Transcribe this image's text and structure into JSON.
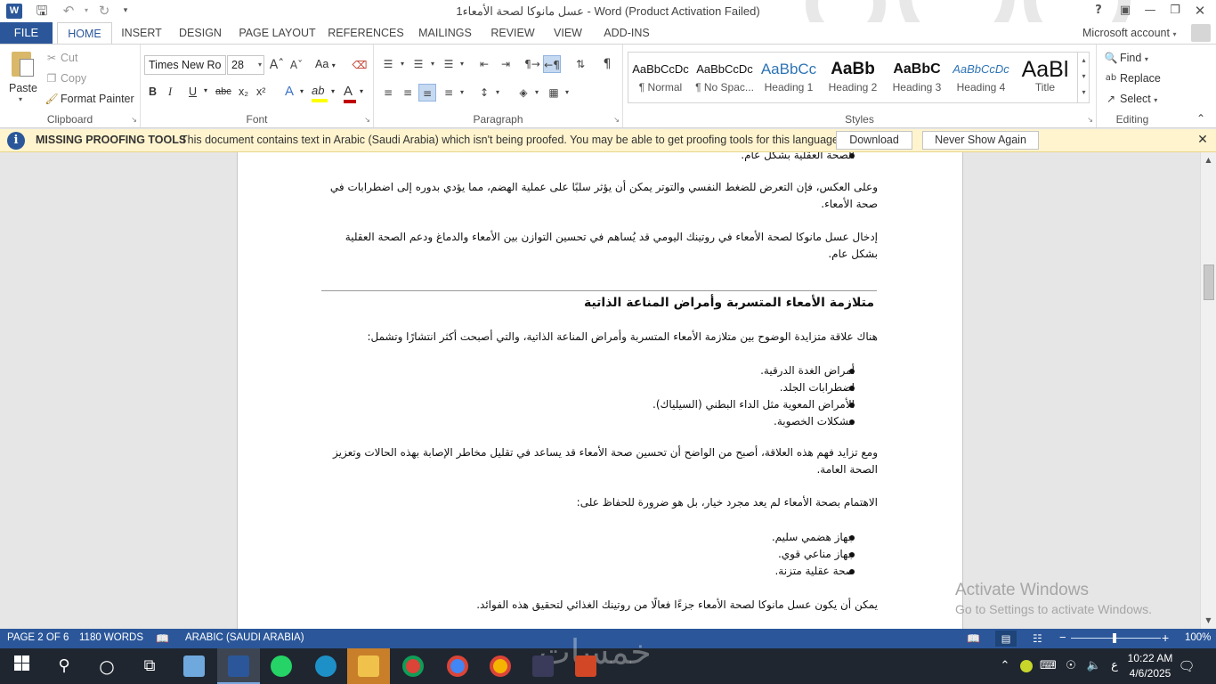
{
  "window": {
    "title": "عسل مانوكا لصحة الأمعاء1 - Word (Product Activation Failed)",
    "app_icon": "W",
    "help": "?",
    "controls": [
      "restore-ribbon-icon",
      "minimize-icon",
      "restore-icon",
      "close-icon"
    ]
  },
  "tabs": {
    "file": "FILE",
    "items": [
      "HOME",
      "INSERT",
      "DESIGN",
      "PAGE LAYOUT",
      "REFERENCES",
      "MAILINGS",
      "REVIEW",
      "VIEW",
      "ADD-INS"
    ],
    "active": "HOME",
    "account": "Microsoft account"
  },
  "ribbon": {
    "clipboard": {
      "label": "Clipboard",
      "paste": "Paste",
      "cut": "Cut",
      "copy": "Copy",
      "format_painter": "Format Painter"
    },
    "font": {
      "label": "Font",
      "family": "Times New Ro",
      "size": "28",
      "change_case": "Aa",
      "bold": "B",
      "italic": "I",
      "underline": "U",
      "strike": "abc",
      "subscript": "x₂",
      "superscript": "x²",
      "effects": "A",
      "highlight": "ab",
      "color": "A",
      "highlight_color": "#ffff00",
      "font_color": "#c00000"
    },
    "paragraph": {
      "label": "Paragraph",
      "pilcrow": "¶"
    },
    "styles": {
      "label": "Styles",
      "items": [
        {
          "preview": "AaBbCcDc",
          "name": "¶ Normal"
        },
        {
          "preview": "AaBbCcDc",
          "name": "¶ No Spac..."
        },
        {
          "preview": "AaBbCc",
          "name": "Heading 1"
        },
        {
          "preview": "AaBb",
          "name": "Heading 2"
        },
        {
          "preview": "AaBbC",
          "name": "Heading 3"
        },
        {
          "preview": "AaBbCcDc",
          "name": "Heading 4"
        },
        {
          "preview": "AaBl",
          "name": "Title"
        }
      ]
    },
    "editing": {
      "label": "Editing",
      "find": "Find",
      "replace": "Replace",
      "select": "Select"
    }
  },
  "notice": {
    "title": "MISSING PROOFING TOOLS",
    "message": "This document contains text in Arabic (Saudi Arabia) which isn't being proofed. You may be able to get proofing tools for this language.",
    "download": "Download",
    "never_show": "Never Show Again"
  },
  "document": {
    "top_bullet": "الصحة العقلية بشكل عام.",
    "para1": "وعلى العكس، فإن التعرض للضغط النفسي والتوتر يمكن أن يؤثر سلبًا على عملية الهضم، مما يؤدي بدوره إلى اضطرابات في صحة الأمعاء.",
    "para2": "إدخال عسل مانوكا لصحة الأمعاء في روتينك اليومي قد يُساهم في تحسين التوازن بين الأمعاء والدماغ ودعم الصحة العقلية بشكل عام.",
    "heading": "متلازمة الأمعاء المتسربة وأمراض المناعة الذاتية",
    "para3": "هناك علاقة متزايدة الوضوح بين متلازمة الأمعاء المتسربة وأمراض المناعة الذاتية، والتي أصبحت أكثر انتشارًا وتشمل:",
    "list1": [
      "أمراض الغدة الدرقية.",
      "اضطرابات الجلد.",
      "الأمراض المعوية مثل الداء البطني (السيلياك).",
      "مشكلات الخصوبة."
    ],
    "para4": "ومع تزايد فهم هذه العلاقة، أصبح من الواضح أن تحسين صحة الأمعاء قد يساعد في تقليل مخاطر الإصابة بهذه الحالات وتعزيز الصحة العامة.",
    "para5": "الاهتمام بصحة الأمعاء لم يعد مجرد خيار، بل هو ضرورة للحفاظ على:",
    "list2": [
      "جهاز هضمي سليم.",
      "جهاز مناعي قوي.",
      "صحة عقلية متزنة."
    ],
    "para6": "يمكن أن يكون عسل مانوكا لصحة الأمعاء جزءًا فعالًا من روتينك الغذائي لتحقيق هذه الفوائد."
  },
  "watermark": {
    "line1": "Activate Windows",
    "line2": "Go to Settings to activate Windows."
  },
  "status": {
    "page": "PAGE 2 OF 6",
    "words": "1180 WORDS",
    "language": "ARABIC (SAUDI ARABIA)",
    "zoom": "100%",
    "zoom_level": 1.0
  },
  "taskbar": {
    "time": "10:22 AM",
    "date": "4/6/2025",
    "ime": "ع",
    "brand_mark": "خمسات"
  }
}
